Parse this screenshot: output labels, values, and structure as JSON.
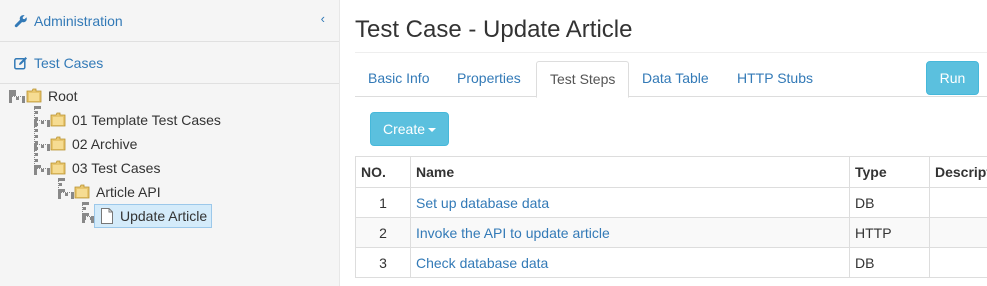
{
  "sidebar": {
    "admin_label": "Administration",
    "admin_icon": "wrench-icon",
    "collapse_icon": "chevron-left-icon",
    "test_cases_label": "Test Cases",
    "test_cases_icon": "edit-icon",
    "tree": {
      "root": "Root",
      "template": "01 Template Test Cases",
      "archive": "02 Archive",
      "test_cases": "03 Test Cases",
      "article_api": "Article API",
      "update_article": "Update Article"
    }
  },
  "main": {
    "title": "Test Case - Update Article",
    "tabs": [
      "Basic Info",
      "Properties",
      "Test Steps",
      "Data Table",
      "HTTP Stubs"
    ],
    "active_tab": "Test Steps",
    "run_label": "Run",
    "create_label": "Create",
    "table": {
      "headers": [
        "NO.",
        "Name",
        "Type",
        "Description"
      ],
      "rows": [
        {
          "no": "1",
          "name": "Set up database data",
          "type": "DB",
          "description": ""
        },
        {
          "no": "2",
          "name": "Invoke the API to update article",
          "type": "HTTP",
          "description": ""
        },
        {
          "no": "3",
          "name": "Check database data",
          "type": "DB",
          "description": ""
        }
      ]
    }
  },
  "colors": {
    "link": "#337ab7",
    "info_button": "#5bc0de",
    "selected_node": "#d4ebfa"
  }
}
